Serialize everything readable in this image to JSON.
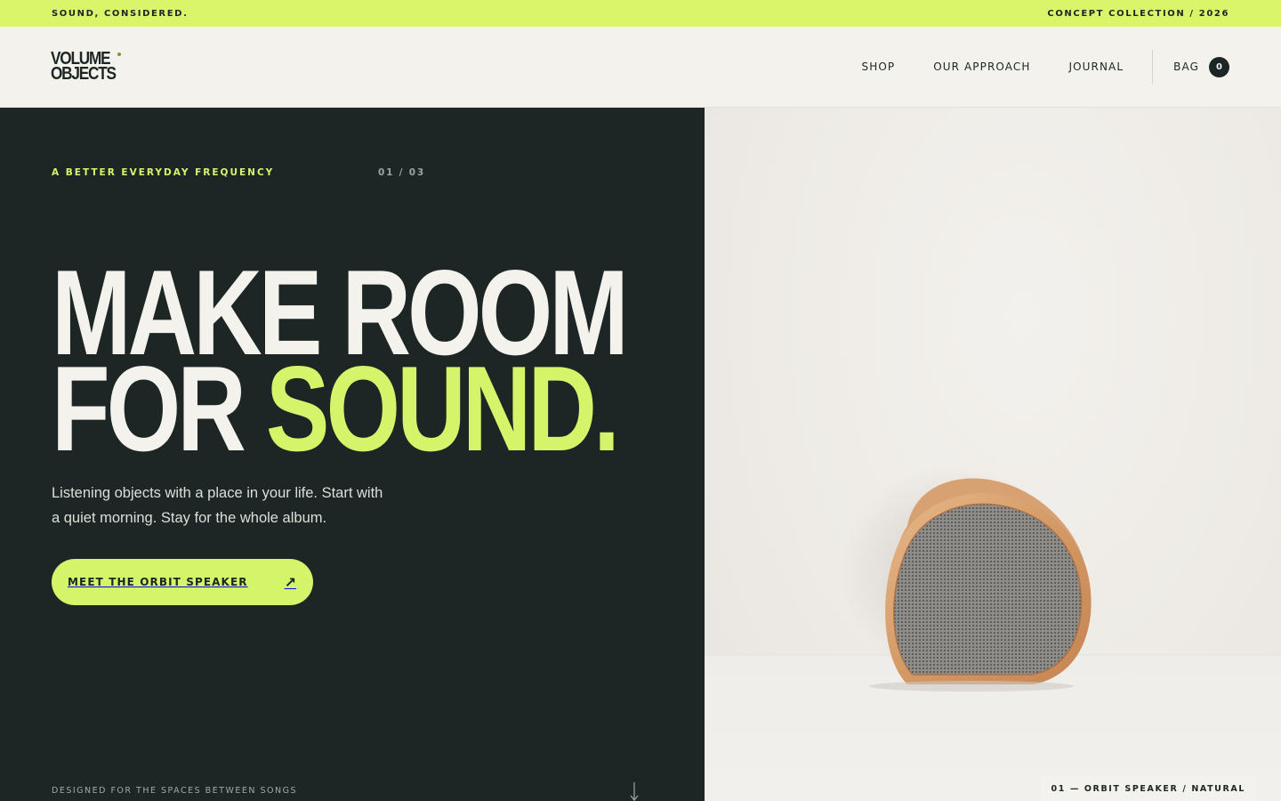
{
  "announcement": {
    "left": "SOUND, CONSIDERED.",
    "right": "CONCEPT COLLECTION / 2026"
  },
  "brand": {
    "line1": "VOLUME",
    "line2": "OBJECTS"
  },
  "nav": {
    "shop": "SHOP",
    "approach": "OUR APPROACH",
    "journal": "JOURNAL",
    "bag": "BAG",
    "bag_count": "0"
  },
  "hero": {
    "eyebrow": "A BETTER EVERYDAY FREQUENCY",
    "counter": "01 / 03",
    "headline_line1": "MAKE ROOM",
    "headline_line2_plain": "FOR ",
    "headline_line2_accent": "SOUND.",
    "subcopy_line1": "Listening objects with a place in your life. Start with",
    "subcopy_line2": "a quiet morning. Stay for the whole album.",
    "cta_label": "MEET THE ORBIT SPEAKER",
    "cta_icon": "arrow-up-right-icon",
    "footnote": "DESIGNED FOR THE SPACES BETWEEN SONGS",
    "scroll_icon": "arrow-down-icon"
  },
  "product_image": {
    "caption": "01 — ORBIT SPEAKER / NATURAL"
  },
  "colors": {
    "accent": "#d4f46a",
    "topbar": "#dbf56b",
    "dark": "#1d2624",
    "cream": "#f4f2ec"
  }
}
